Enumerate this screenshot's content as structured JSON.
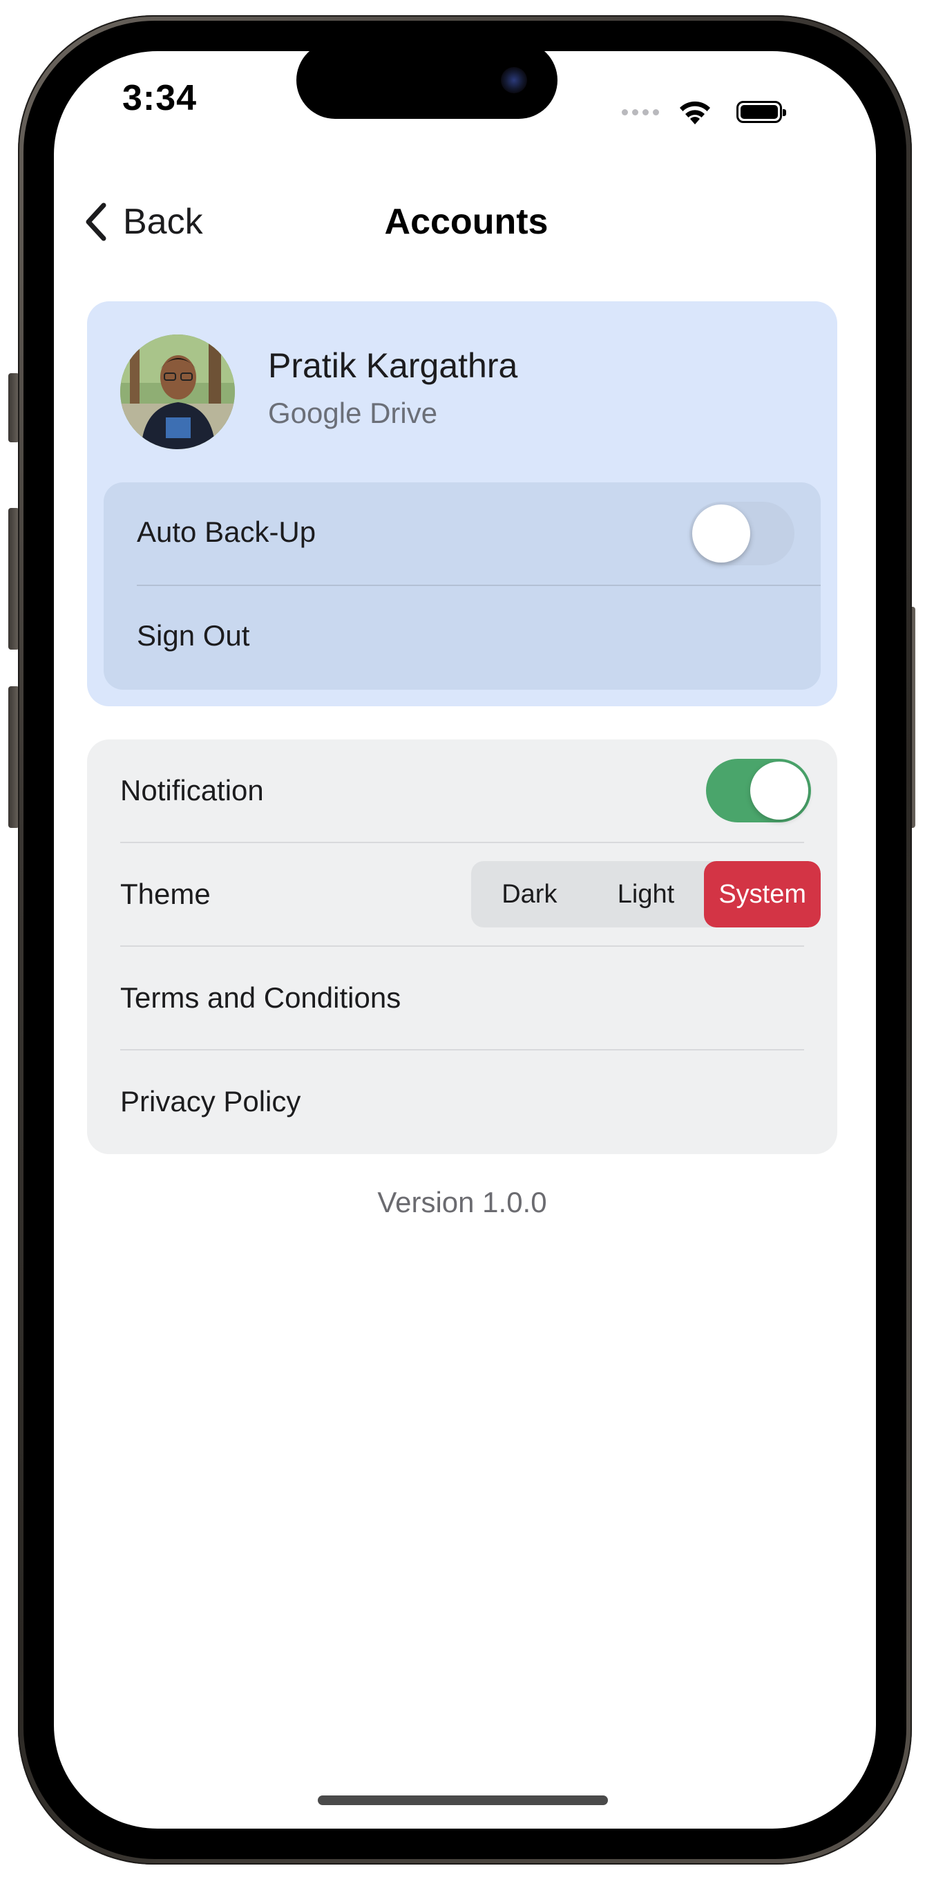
{
  "status_bar": {
    "time": "3:34"
  },
  "nav": {
    "back_label": "Back",
    "title": "Accounts"
  },
  "account": {
    "name": "Pratik Kargathra",
    "service": "Google Drive",
    "auto_backup_label": "Auto Back-Up",
    "auto_backup_enabled": false,
    "sign_out_label": "Sign Out"
  },
  "settings": {
    "notification_label": "Notification",
    "notification_enabled": true,
    "theme_label": "Theme",
    "theme_options": [
      "Dark",
      "Light",
      "System"
    ],
    "theme_selected": "System",
    "terms_label": "Terms and Conditions",
    "privacy_label": "Privacy Policy"
  },
  "footer": {
    "version": "Version 1.0.0"
  },
  "colors": {
    "account_card_bg": "#dae6fb",
    "account_inner_bg": "#c9d8ef",
    "settings_card_bg": "#eff0f1",
    "toggle_on": "#4aa56b",
    "theme_selected_bg": "#d33445"
  },
  "icons": {
    "back": "chevron-left-icon",
    "wifi": "wifi-icon",
    "battery": "battery-icon",
    "signal": "signal-dots-icon"
  }
}
